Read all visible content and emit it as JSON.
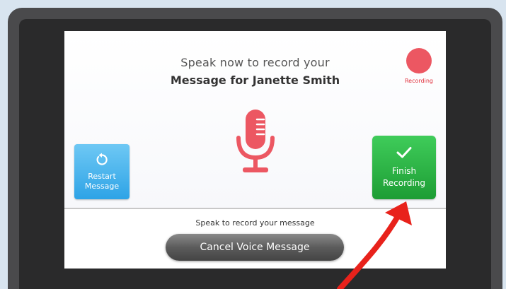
{
  "screen": {
    "title_line1": "Speak now to record your",
    "title_line2": "Message for Janette Smith",
    "recording_label": "Recording",
    "prompt": "Speak to record your message"
  },
  "buttons": {
    "restart": {
      "line1": "Restart",
      "line2": "Message"
    },
    "finish": {
      "line1": "Finish",
      "line2": "Recording"
    },
    "cancel": "Cancel Voice Message"
  },
  "icons": {
    "recording_indicator": "record-dot-icon",
    "microphone": "microphone-icon",
    "restart": "restart-arrow-icon",
    "finish": "checkmark-icon",
    "annotation": "red-arrow-icon"
  },
  "colors": {
    "recording_red": "#ec5762",
    "restart_blue": "#2ea3e6",
    "finish_green": "#1d9d34",
    "cancel_gray": "#5c5c5c",
    "annotation_red": "#e8221b"
  }
}
